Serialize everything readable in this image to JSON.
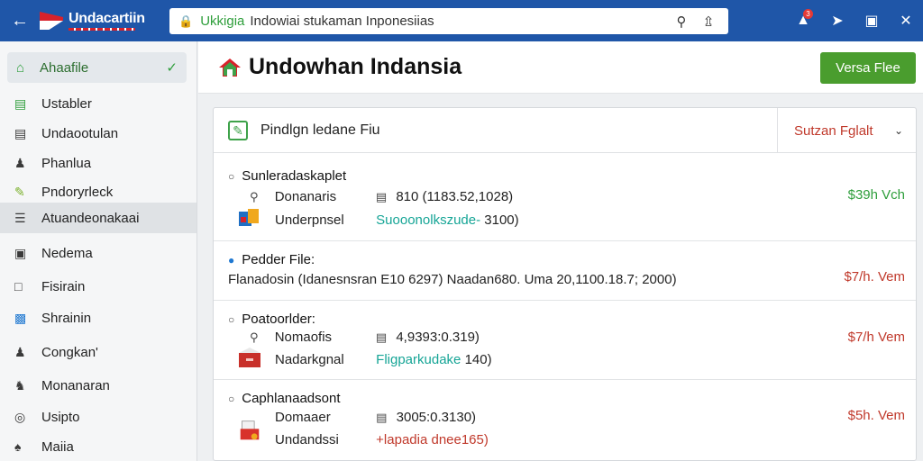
{
  "topbar": {
    "brand": "Undacartiin",
    "url_domain": "Ukkigia",
    "url_rest": "Indowiai stukaman Inponesiias"
  },
  "sidebar": {
    "top_item": "Ahaafile",
    "items": [
      {
        "label": "Ustabler"
      },
      {
        "label": "Undaootulan"
      },
      {
        "label": "Phanlua"
      },
      {
        "label": "Pndoryrleck"
      },
      {
        "label": "Atuandeonakaai"
      },
      {
        "label": "Nedema"
      },
      {
        "label": "Fisirain"
      },
      {
        "label": "Shrainin"
      },
      {
        "label": "Congkan'"
      },
      {
        "label": "Monanaran"
      },
      {
        "label": "Usipto"
      },
      {
        "label": "Maiia"
      }
    ]
  },
  "header": {
    "title": "Undowhan Indansia",
    "button": "Versa Flee"
  },
  "card": {
    "title": "Pindlgn ledane Fiu",
    "sort_label": "Sutzan Fglalt",
    "rows": [
      {
        "title": "Sunleradaskaplet",
        "line1_key": "Donanaris",
        "line1_val": "810 (1183.52,1028)",
        "line2_key": "Underpnsel",
        "line2_val_colored": "Suooonolkszude-",
        "line2_val_plain": "3100)",
        "price": "$39h Vch"
      },
      {
        "title": "Pedder File:",
        "line1": "Flanadosin (Idanesnsran E10 6297) Naadan680. Uma 20,1100.18.7; 2000)",
        "price": "$7/h. Vem"
      },
      {
        "title": "Poatoorlder:",
        "line1_key": "Nomaofis",
        "line1_val": "4,9393:0.319)",
        "line2_key": "Nadarkgnal",
        "line2_val_colored": "Fligparkudake",
        "line2_val_plain": "140)",
        "price": "$7/h Vem"
      },
      {
        "title": "Caphlanaadsont",
        "line1_key": "Domaaer",
        "line1_val": "3005:0.3130)",
        "line2_key": "Undandssi",
        "line2_val_colored": "+lapadia dnee165)",
        "line2_val_plain": "",
        "price": "$5h. Vem"
      }
    ]
  }
}
